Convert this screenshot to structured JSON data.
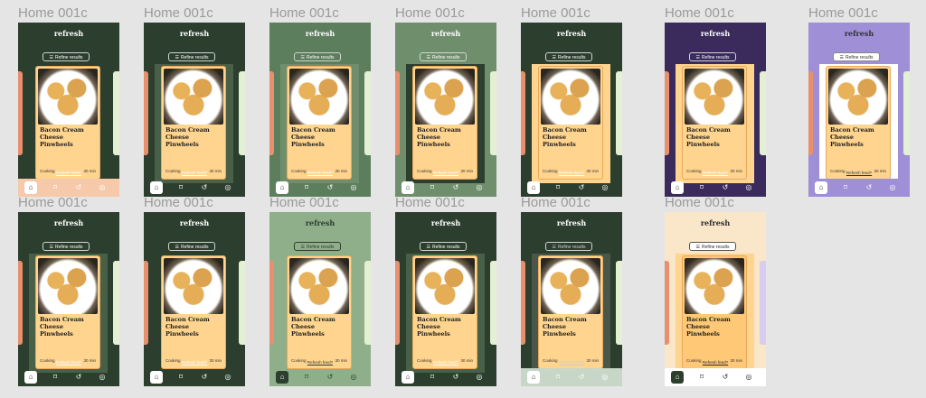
{
  "frames": [
    {
      "title": "Home 001c",
      "brand": "refresh",
      "refine": "Refine results",
      "recipe": "Bacon Cream Cheese Pinwheels",
      "category": "Cooking",
      "time": "30 min",
      "refresh_link": "Refresh feed?"
    },
    {
      "title": "Home 001c",
      "brand": "refresh",
      "refine": "Refine results",
      "recipe": "Bacon Cream Cheese Pinwheels",
      "category": "Cooking",
      "time": "30 min",
      "refresh_link": "Refresh feed?"
    },
    {
      "title": "Home 001c",
      "brand": "refresh",
      "refine": "Refine results",
      "recipe": "Bacon Cream Cheese Pinwheels",
      "category": "Cooking",
      "time": "30 min",
      "refresh_link": "Refresh feed?"
    },
    {
      "title": "Home 001c",
      "brand": "refresh",
      "refine": "Refine results",
      "recipe": "Bacon Cream Cheese Pinwheels",
      "category": "Cooking",
      "time": "30 min",
      "refresh_link": "Refresh feed?"
    },
    {
      "title": "Home 001c",
      "brand": "refresh",
      "refine": "Refine results",
      "recipe": "Bacon Cream Cheese Pinwheels",
      "category": "Cooking",
      "time": "30 min",
      "refresh_link": "Refresh feed?"
    },
    {
      "title": "Home 001c",
      "brand": "refresh",
      "refine": "Refine results",
      "recipe": "Bacon Cream Cheese Pinwheels",
      "category": "Cooking",
      "time": "30 min",
      "refresh_link": "Refresh feed?"
    },
    {
      "title": "Home 001c",
      "brand": "refresh",
      "refine": "Refine results",
      "recipe": "Bacon Cream Cheese Pinwheels",
      "category": "Cooking",
      "time": "30 min",
      "refresh_link": "Refresh feed?"
    },
    {
      "title": "Home 001c",
      "brand": "refresh",
      "refine": "Refine results",
      "recipe": "Bacon Cream Cheese Pinwheels",
      "category": "Cooking",
      "time": "30 min",
      "refresh_link": "Refresh feed?"
    },
    {
      "title": "Home 001c",
      "brand": "refresh",
      "refine": "Refine results",
      "recipe": "Bacon Cream Cheese Pinwheels",
      "category": "Cooking",
      "time": "30 min",
      "refresh_link": "Refresh feed?"
    },
    {
      "title": "Home 001c",
      "brand": "refresh",
      "refine": "Refine results",
      "recipe": "Bacon Cream Cheese Pinwheels",
      "category": "Cooking",
      "time": "30 min",
      "refresh_link": "Refresh feed?"
    },
    {
      "title": "Home 001c",
      "brand": "refresh",
      "refine": "Refine results",
      "recipe": "Bacon Cream Cheese Pinwheels",
      "category": "Cooking",
      "time": "30 min",
      "refresh_link": "Refresh feed?"
    },
    {
      "title": "Home 001c",
      "brand": "refresh",
      "refine": "Refine results",
      "recipe": "Bacon Cream Cheese Pinwheels",
      "category": "Cooking",
      "time": "30 min",
      "refresh_link": "Refresh feed?"
    },
    {
      "title": "Home 001c",
      "brand": "refresh",
      "refine": "Refine results",
      "recipe": "Bacon Cream Cheese Pinwheels",
      "category": "Cooking",
      "time": "30 min",
      "refresh_link": "Refresh feed?"
    }
  ],
  "nav_icons": [
    "home-icon",
    "bookmark-icon",
    "history-icon",
    "profile-icon"
  ],
  "colors": {
    "canvas": "#e5e5e5",
    "forest": "#2c3e2e",
    "sage": "#6f8f6c",
    "peach": "#ffd48e",
    "purple": "#3a2b5c",
    "lavender": "#9e8fd6",
    "cream": "#fae6c8"
  }
}
